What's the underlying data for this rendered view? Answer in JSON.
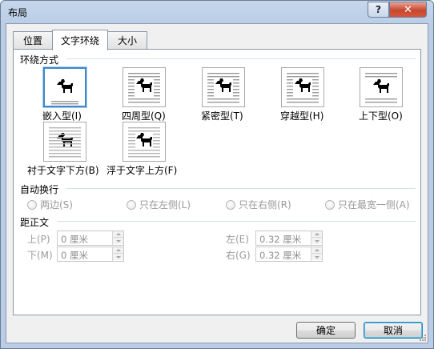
{
  "window": {
    "title": "布局",
    "help_label": "?",
    "close_label": "✕"
  },
  "tabs": [
    {
      "label": "位置",
      "active": false
    },
    {
      "label": "文字环绕",
      "active": true
    },
    {
      "label": "大小",
      "active": false
    }
  ],
  "wrap_style": {
    "title": "环绕方式",
    "options": [
      {
        "label": "嵌入型(I)",
        "icon": "inline-wrap-icon",
        "selected": true
      },
      {
        "label": "四周型(Q)",
        "icon": "square-wrap-icon",
        "selected": false
      },
      {
        "label": "紧密型(T)",
        "icon": "tight-wrap-icon",
        "selected": false
      },
      {
        "label": "穿越型(H)",
        "icon": "through-wrap-icon",
        "selected": false
      },
      {
        "label": "上下型(O)",
        "icon": "top-bottom-wrap-icon",
        "selected": false
      },
      {
        "label": "衬于文字下方(B)",
        "icon": "behind-text-icon",
        "selected": false
      },
      {
        "label": "浮于文字上方(F)",
        "icon": "in-front-text-icon",
        "selected": false
      }
    ]
  },
  "wrap_text": {
    "title": "自动换行",
    "options": [
      {
        "label": "两边(S)"
      },
      {
        "label": "只在左侧(L)"
      },
      {
        "label": "只在右侧(R)"
      },
      {
        "label": "只在最宽一侧(A)"
      }
    ]
  },
  "distance": {
    "title": "距正文",
    "top": {
      "label": "上(P)",
      "value": "0 厘米"
    },
    "bottom": {
      "label": "下(M)",
      "value": "0 厘米"
    },
    "left": {
      "label": "左(E)",
      "value": "0.32 厘米"
    },
    "right": {
      "label": "右(G)",
      "value": "0.32 厘米"
    }
  },
  "buttons": {
    "ok": "确定",
    "cancel": "取消"
  },
  "colors": {
    "selection_border": "#3f88c8",
    "close_red": "#c6472f",
    "title_bar": "#b9cde6"
  }
}
